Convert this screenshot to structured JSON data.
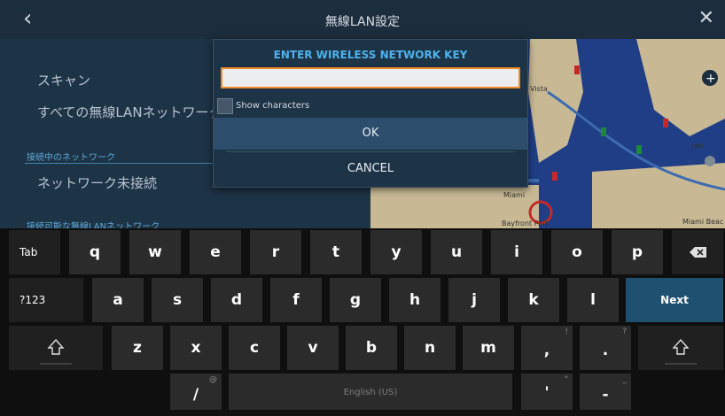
{
  "titlebar": {
    "title": "無線LAN設定",
    "back_icon": "chevron-left-icon",
    "close_icon": "close-icon"
  },
  "settings": {
    "scan": "スキャン",
    "show_all": "すべての無線LANネットワークを",
    "connected_section": "接続中のネットワーク",
    "not_connected": "ネットワーク未接続",
    "available_section": "接続可能な無線LANネットワーク"
  },
  "map": {
    "labels": [
      "Miami",
      "Bayfront Park",
      "Miami Beac",
      "Vista",
      "Lak"
    ],
    "colors": {
      "water": "#1f3e86",
      "land": "#c8b994",
      "channel": "#3d6bb0"
    }
  },
  "dialog": {
    "title": "ENTER WIRELESS NETWORK KEY",
    "key_value": "",
    "show_characters": "Show characters",
    "show_characters_checked": false,
    "ok": "OK",
    "cancel": "CANCEL"
  },
  "keyboard": {
    "row1": {
      "tab": "Tab",
      "keys": [
        "q",
        "w",
        "e",
        "r",
        "t",
        "y",
        "u",
        "i",
        "o",
        "p"
      ],
      "backspace_icon": "backspace-icon"
    },
    "row2": {
      "symbols": "?123",
      "keys": [
        "a",
        "s",
        "d",
        "f",
        "g",
        "h",
        "j",
        "k",
        "l"
      ],
      "next": "Next"
    },
    "row3": {
      "shift_icon": "shift-icon",
      "keys": [
        "z",
        "x",
        "c",
        "v",
        "b",
        "n",
        "m"
      ],
      "comma": ",",
      "comma_hint": "!",
      "period": ".",
      "period_hint": "?",
      "shift": "⇧"
    },
    "row4": {
      "slash": "/",
      "slash_hint": "@",
      "space": "English (US)",
      "apostrophe": "'",
      "apostrophe_hint": "\"",
      "dash": "-",
      "dash_hint": "_"
    }
  },
  "colors": {
    "accent": "#4db2ee",
    "input_border": "#f08a24",
    "next_key": "#205070"
  }
}
